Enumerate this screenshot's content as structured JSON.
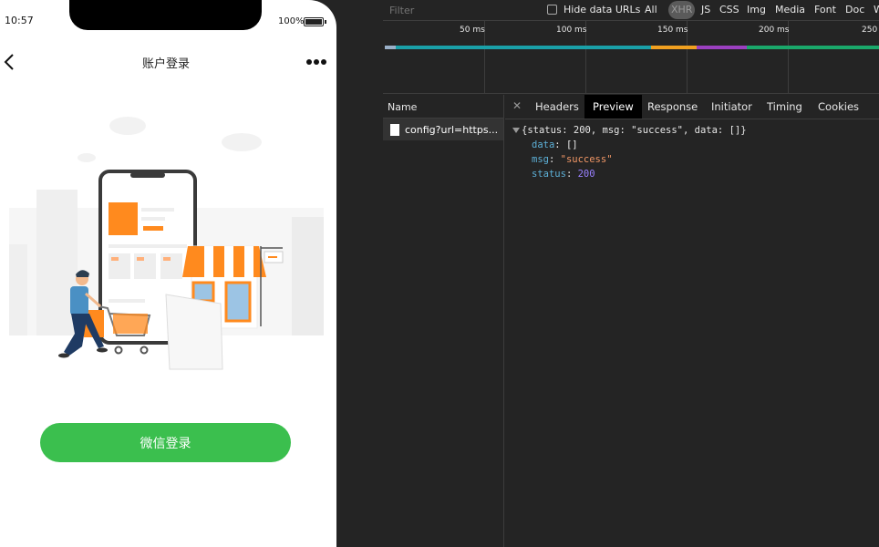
{
  "phone": {
    "status_time": "10:57",
    "battery_percent": "100%",
    "nav_title": "账户登录",
    "login_button": "微信登录"
  },
  "devtools": {
    "filter_placeholder": "Filter",
    "hide_data_urls_label": "Hide data URLs",
    "filter_types": [
      "All",
      "XHR",
      "JS",
      "CSS",
      "Img",
      "Media",
      "Font",
      "Doc",
      "W"
    ],
    "active_filter": "XHR",
    "timeline_ticks": [
      "50 ms",
      "100 ms",
      "150 ms",
      "200 ms",
      "250"
    ],
    "name_header": "Name",
    "requests": [
      {
        "name": "config?url=https..."
      }
    ],
    "tabs": [
      "Headers",
      "Preview",
      "Response",
      "Initiator",
      "Timing",
      "Cookies"
    ],
    "active_tab": "Preview",
    "preview": {
      "summary": "{status: 200, msg: \"success\", data: []}",
      "fields": [
        {
          "key": "data",
          "value": "[]",
          "type": "plain"
        },
        {
          "key": "msg",
          "value": "\"success\"",
          "type": "string"
        },
        {
          "key": "status",
          "value": "200",
          "type": "number"
        }
      ]
    }
  },
  "colors": {
    "login_green": "#3bbf4e",
    "json_key": "#5db0d7",
    "json_string": "#f29766",
    "json_number": "#9980ff"
  }
}
